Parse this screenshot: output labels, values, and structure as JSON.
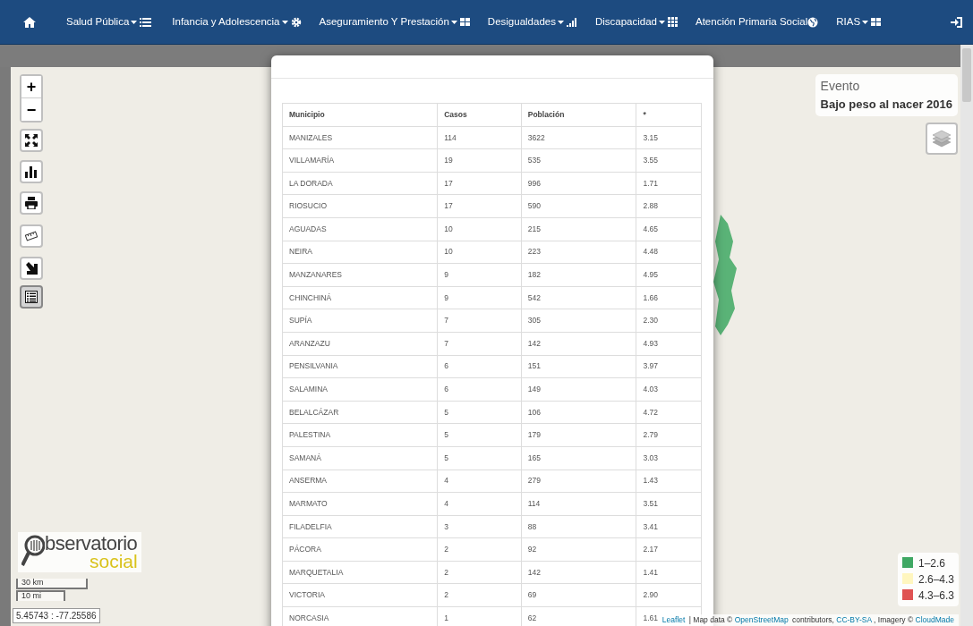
{
  "navbar": {
    "items": [
      {
        "label": "Salud Pública",
        "dropdown": true
      },
      {
        "label": "Infancia y Adolescencia",
        "dropdown": true
      },
      {
        "label": "Aseguramiento Y Prestación",
        "dropdown": true
      },
      {
        "label": "Desigualdades",
        "dropdown": true
      },
      {
        "label": "Discapacidad",
        "dropdown": true
      },
      {
        "label": "Atención Primaria Social",
        "dropdown": false
      },
      {
        "label": "RIAS",
        "dropdown": true
      }
    ]
  },
  "map": {
    "controls": {
      "zoom_in": "+",
      "zoom_out": "−",
      "tools": [
        {
          "selected": false
        },
        {
          "selected": false
        },
        {
          "selected": false
        },
        {
          "selected": false
        },
        {
          "selected": false
        },
        {
          "selected": true
        }
      ]
    },
    "event": {
      "title": "Evento",
      "value": "Bajo peso al nacer 2016"
    },
    "logo": {
      "word": "bservatorio",
      "sub": "social"
    },
    "scale": {
      "metric": "30 km",
      "imperial": "10 mi"
    },
    "coordinates": "5.45743 : -77.25586",
    "legend": [
      {
        "label": "1–2.6",
        "color": "#3fa863"
      },
      {
        "label": "2.6–4.3",
        "color": "#fff6bf"
      },
      {
        "label": "4.3–6.3",
        "color": "#df5252"
      }
    ],
    "attribution": [
      {
        "text": "Leaflet",
        "link": true
      },
      {
        "text": " | Map data © ",
        "link": false
      },
      {
        "text": "OpenStreetMap",
        "link": true
      },
      {
        "text": " contributors, ",
        "link": false
      },
      {
        "text": "CC-BY-SA",
        "link": true
      },
      {
        "text": ", Imagery © ",
        "link": false
      },
      {
        "text": "CloudMade",
        "link": true
      }
    ]
  },
  "modal": {
    "table": {
      "columns": [
        "Municipio",
        "Casos",
        "Población",
        "*"
      ],
      "rows": [
        [
          "MANIZALES",
          "114",
          "3622",
          "3.15"
        ],
        [
          "VILLAMARÍA",
          "19",
          "535",
          "3.55"
        ],
        [
          "LA DORADA",
          "17",
          "996",
          "1.71"
        ],
        [
          "RIOSUCIO",
          "17",
          "590",
          "2.88"
        ],
        [
          "AGUADAS",
          "10",
          "215",
          "4.65"
        ],
        [
          "NEIRA",
          "10",
          "223",
          "4.48"
        ],
        [
          "MANZANARES",
          "9",
          "182",
          "4.95"
        ],
        [
          "CHINCHINÁ",
          "9",
          "542",
          "1.66"
        ],
        [
          "SUPÍA",
          "7",
          "305",
          "2.30"
        ],
        [
          "ARANZAZU",
          "7",
          "142",
          "4.93"
        ],
        [
          "PENSILVANIA",
          "6",
          "151",
          "3.97"
        ],
        [
          "SALAMINA",
          "6",
          "149",
          "4.03"
        ],
        [
          "BELALCÁZAR",
          "5",
          "106",
          "4.72"
        ],
        [
          "PALESTINA",
          "5",
          "179",
          "2.79"
        ],
        [
          "SAMANÁ",
          "5",
          "165",
          "3.03"
        ],
        [
          "ANSERMA",
          "4",
          "279",
          "1.43"
        ],
        [
          "MARMATO",
          "4",
          "114",
          "3.51"
        ],
        [
          "FILADELFIA",
          "3",
          "88",
          "3.41"
        ],
        [
          "PÁCORA",
          "2",
          "92",
          "2.17"
        ],
        [
          "MARQUETALIA",
          "2",
          "142",
          "1.41"
        ],
        [
          "VICTORIA",
          "2",
          "69",
          "2.90"
        ],
        [
          "NORCASIA",
          "1",
          "62",
          "1.61"
        ]
      ]
    }
  }
}
